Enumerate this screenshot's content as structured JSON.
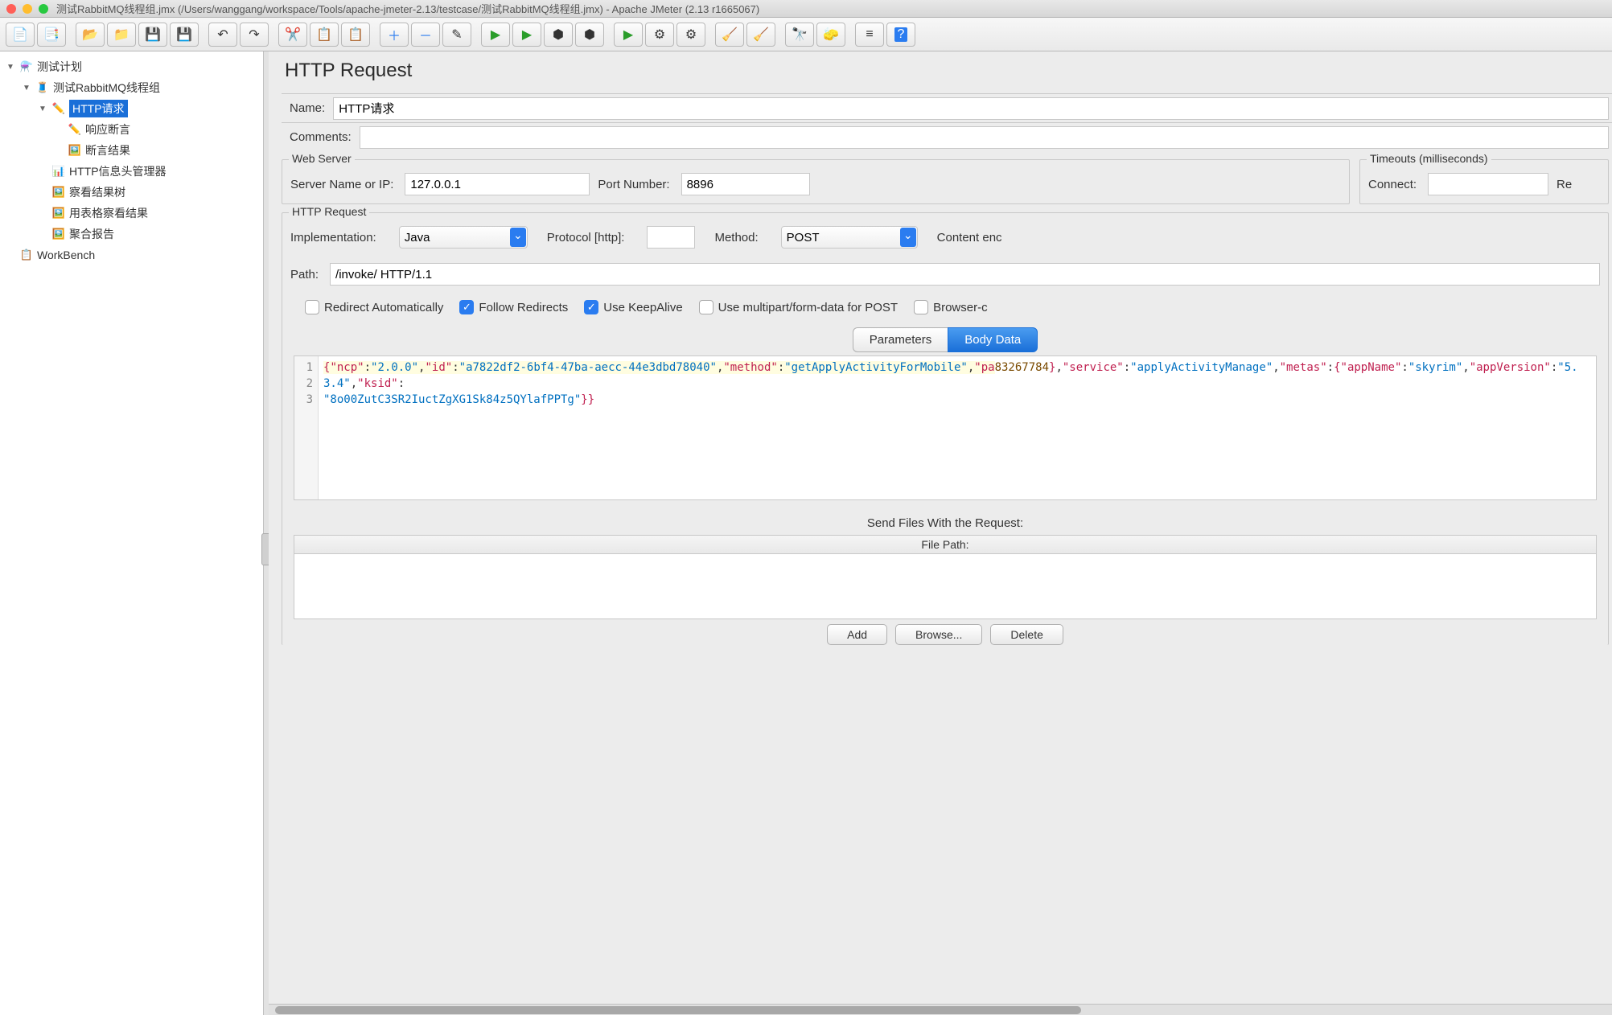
{
  "titlebar": "测试RabbitMQ线程组.jmx (/Users/wanggang/workspace/Tools/apache-jmeter-2.13/testcase/测试RabbitMQ线程组.jmx) - Apache JMeter (2.13 r1665067)",
  "tree": {
    "root": "测试计划",
    "threadgroup": "测试RabbitMQ线程组",
    "http": "HTTP请求",
    "assert": "响应断言",
    "assert_result": "断言结果",
    "header_mgr": "HTTP信息头管理器",
    "view_tree": "察看结果树",
    "table_result": "用表格察看结果",
    "aggregate": "聚合报告",
    "workbench": "WorkBench"
  },
  "panel": {
    "title": "HTTP Request",
    "name_label": "Name:",
    "name_value": "HTTP请求",
    "comments_label": "Comments:",
    "comments_value": ""
  },
  "webserver": {
    "legend": "Web Server",
    "server_label": "Server Name or IP:",
    "server_value": "127.0.0.1",
    "port_label": "Port Number:",
    "port_value": "8896"
  },
  "timeouts": {
    "legend": "Timeouts (milliseconds)",
    "connect_label": "Connect:",
    "connect_value": "",
    "response_label": "Re"
  },
  "httpreq": {
    "legend": "HTTP Request",
    "impl_label": "Implementation:",
    "impl_value": "Java",
    "protocol_label": "Protocol [http]:",
    "protocol_value": "",
    "method_label": "Method:",
    "method_value": "POST",
    "encoding_label": "Content enc",
    "path_label": "Path:",
    "path_value": "/invoke/ HTTP/1.1",
    "chk_redirect": "Redirect Automatically",
    "chk_follow": "Follow Redirects",
    "chk_keepalive": "Use KeepAlive",
    "chk_multipart": "Use multipart/form-data for POST",
    "chk_browser": "Browser-c"
  },
  "tabs": {
    "params": "Parameters",
    "body": "Body Data"
  },
  "body_json_display": "{\"ncp\":\"2.0.0\",\"id\":\"a7822df2-6bf4-47ba-aecc-44e3dbd78040\",\"method\":\"getApplyActivityForMobile\",\"par… 83267784},\"service\":\"applyActivityManage\",\"metas\":{\"appName\":\"skyrim\",\"appVersion\":\"5.3.4\",\"ksid\":\"8o00ZutC3SR2IuctZgXG1Sk84z5QYlafPPTg\"}}",
  "files": {
    "title": "Send Files With the Request:",
    "col": "File Path:"
  },
  "btns": {
    "add": "Add",
    "browse": "Browse...",
    "delete": "Delete"
  }
}
